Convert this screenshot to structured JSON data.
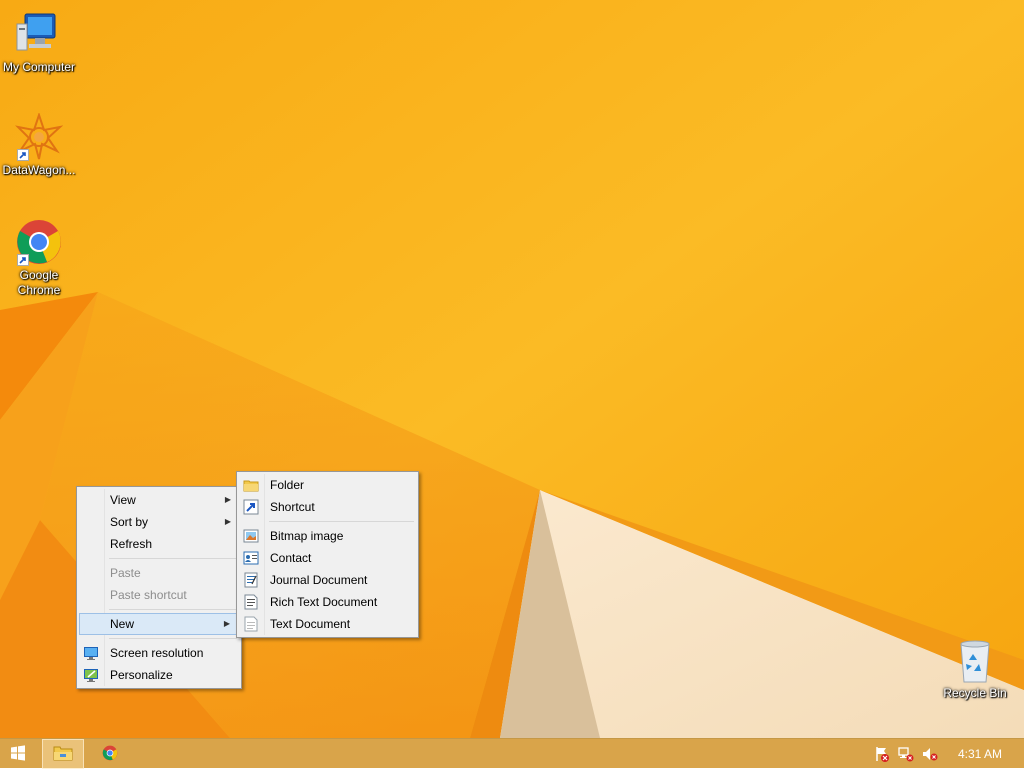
{
  "desktop": {
    "icons": [
      {
        "label": "My Computer",
        "icon": "computer-icon"
      },
      {
        "label": "DataWagon...",
        "icon": "datawagon-icon"
      },
      {
        "label": "Google Chrome",
        "icon": "chrome-icon"
      },
      {
        "label": "Recycle Bin",
        "icon": "recycle-bin-icon"
      }
    ]
  },
  "context_menu": {
    "items": [
      {
        "label": "View",
        "submenu": true
      },
      {
        "label": "Sort by",
        "submenu": true
      },
      {
        "label": "Refresh"
      },
      {
        "label": "Paste",
        "disabled": true
      },
      {
        "label": "Paste shortcut",
        "disabled": true
      },
      {
        "label": "New",
        "submenu": true,
        "highlighted": true
      },
      {
        "label": "Screen resolution",
        "icon": "screen-resolution-icon"
      },
      {
        "label": "Personalize",
        "icon": "personalize-icon"
      }
    ]
  },
  "new_submenu": {
    "items": [
      {
        "label": "Folder",
        "icon": "folder-icon"
      },
      {
        "label": "Shortcut",
        "icon": "shortcut-icon"
      },
      {
        "label": "Bitmap image",
        "icon": "bitmap-icon"
      },
      {
        "label": "Contact",
        "icon": "contact-icon"
      },
      {
        "label": "Journal Document",
        "icon": "journal-icon"
      },
      {
        "label": "Rich Text Document",
        "icon": "rtf-icon"
      },
      {
        "label": "Text Document",
        "icon": "text-document-icon"
      }
    ]
  },
  "taskbar": {
    "clock": "4:31 AM",
    "pinned": [
      "start-icon",
      "file-explorer-icon",
      "chrome-icon"
    ],
    "tray": [
      "action-center-flag-icon",
      "network-icon",
      "volume-muted-icon"
    ]
  },
  "colors": {
    "wallpaper": "#f9b21a",
    "taskbar": "#d9a44a",
    "menu_bg": "#f0f0f0",
    "menu_highlight": "#dae9f7"
  }
}
